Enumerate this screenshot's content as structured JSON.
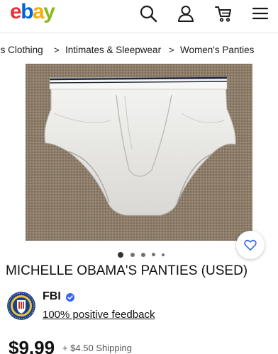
{
  "header": {
    "logo": {
      "e": "e",
      "b": "b",
      "a": "a",
      "y": "y"
    },
    "icons": [
      "search-icon",
      "user-icon",
      "cart-icon",
      "menu-icon"
    ]
  },
  "breadcrumb": {
    "items": [
      "'s Clothing",
      "Intimates & Sleepwear",
      "Women's Panties"
    ],
    "separator": ">"
  },
  "listing": {
    "title": "MICHELLE OBAMA'S PANTIES (USED)",
    "image_count_dots": 5,
    "active_dot": 0
  },
  "seller": {
    "name": "FBI",
    "feedback": "100% positive feedback"
  },
  "price": {
    "amount": "$9.99",
    "shipping": "+ $4.50 Shipping"
  },
  "colors": {
    "ebay_red": "#e53238",
    "ebay_blue": "#0064d2",
    "ebay_yellow": "#f5af02",
    "ebay_green": "#86b817",
    "verified_blue": "#3665f3",
    "favorite_blue": "#3665f3"
  }
}
